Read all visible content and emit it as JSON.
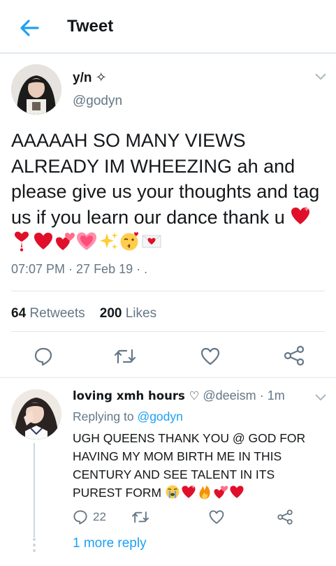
{
  "header": {
    "title": "Tweet",
    "back_icon": "arrow-left-icon"
  },
  "tweet": {
    "author_name": "y/n",
    "author_symbol": "✧",
    "author_handle": "@godyn",
    "text": "AAAAAH SO MANY VIEWS ALREADY IM WHEEZING ah and please give us your thoughts and tag us if you learn our dance thank u",
    "emojis": [
      "sparkling-heart",
      "heart-exclamation",
      "red-heart",
      "two-hearts",
      "growing-heart",
      "sparkles",
      "kissing-face",
      "love-letter"
    ],
    "time": "07:07 PM · 27 Feb 19 · .",
    "retweets_count": "64",
    "retweets_label": "Retweets",
    "likes_count": "200",
    "likes_label": "Likes"
  },
  "reply": {
    "author_name": "loving xmh hours ♡",
    "author_handle": "@deeism",
    "time": "· 1m",
    "replying_label": "Replying to",
    "replying_handle": "@godyn",
    "text": "UGH QUEENS THANK YOU @ GOD FOR HAVING MY MOM BIRTH ME IN THIS CENTURY AND SEE TALENT IN ITS PUREST FORM",
    "emojis": [
      "crying-face",
      "sparkling-heart",
      "fire",
      "two-hearts",
      "red-heart"
    ],
    "reply_count": "22",
    "more_replies": "1 more reply"
  },
  "colors": {
    "accent": "#1da1f2",
    "secondary": "#657786",
    "divider": "#e1e8ed",
    "heart": "#e0102a"
  }
}
